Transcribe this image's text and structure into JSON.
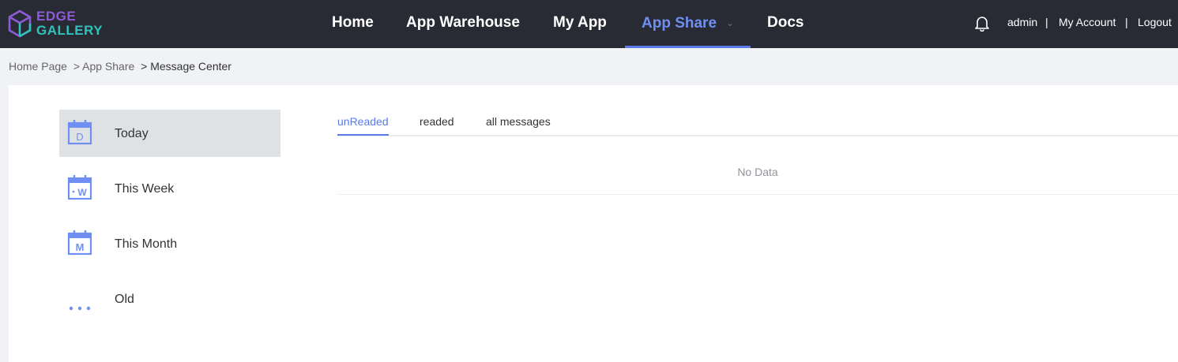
{
  "brand": {
    "line1": "EDGE",
    "line2": "GALLERY"
  },
  "nav": {
    "home": "Home",
    "warehouse": "App Warehouse",
    "myapp": "My App",
    "appshare": "App Share",
    "docs": "Docs"
  },
  "user": {
    "name": "admin",
    "separator": "|",
    "account": "My Account",
    "logout": "Logout"
  },
  "breadcrumb": {
    "home": "Home Page",
    "share": "> App Share",
    "current": "> Message Center"
  },
  "sidebar": {
    "items": [
      {
        "label": "Today",
        "icon_letter": "D"
      },
      {
        "label": "This Week",
        "icon_letter": "W"
      },
      {
        "label": "This Month",
        "icon_letter": "M"
      },
      {
        "label": "Old"
      }
    ]
  },
  "tabs": {
    "unread": "unReaded",
    "read": "readed",
    "all": "all messages"
  },
  "table": {
    "empty_text": "No Data"
  },
  "colors": {
    "accent": "#5b7be8",
    "topbar": "#282b33",
    "brand_purple": "#8e5bd8",
    "brand_teal": "#2fc3bd"
  }
}
